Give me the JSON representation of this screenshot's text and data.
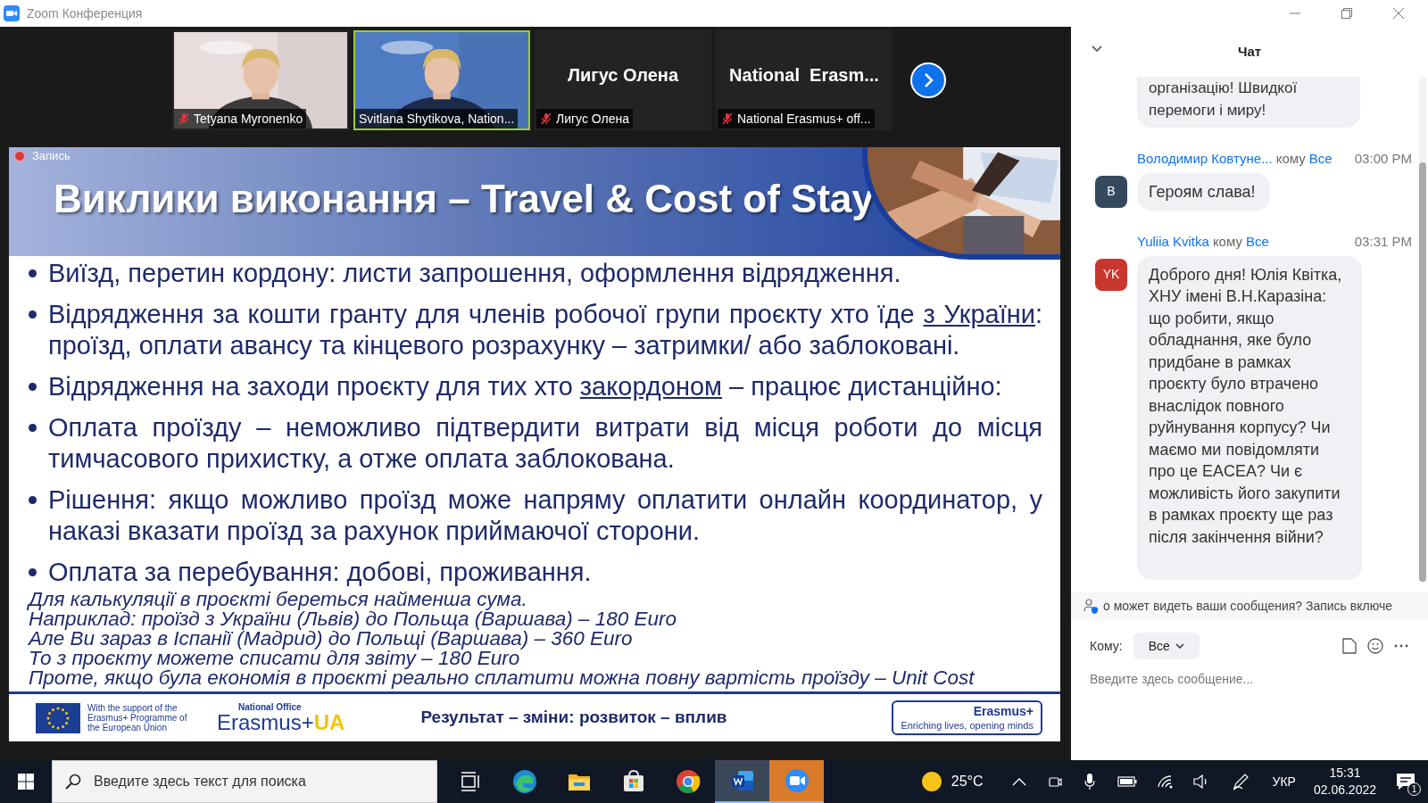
{
  "window": {
    "title": "Zoom Конференция"
  },
  "videos": [
    {
      "name": "Tetyana Myronenko",
      "kind": "camera",
      "muted": true,
      "speaking": false
    },
    {
      "name": "Svitlana Shytikova, Nation...",
      "kind": "camera",
      "muted": false,
      "speaking": true
    },
    {
      "name": "Лигус Олена",
      "kind": "name",
      "display": "Лигус Олена",
      "muted": true,
      "speaking": false
    },
    {
      "name": "National Erasmus+ off...",
      "kind": "name",
      "display": "National  Erasm...",
      "muted": true,
      "speaking": false
    }
  ],
  "recording": {
    "label": "Запись"
  },
  "slide": {
    "title": "Виклики виконання – Travel & Cost of Stay",
    "bullets": [
      {
        "segments": [
          {
            "text": "Виїзд, перетин кордону: листи запрошення, оформлення відрядження.",
            "underline": false
          }
        ]
      },
      {
        "segments": [
          {
            "text": "Відрядження за кошти гранту для членів робочої групи проєкту хто їде ",
            "underline": false
          },
          {
            "text": "з України",
            "underline": true
          },
          {
            "text": ": проїзд, оплати авансу та кінцевого розрахунку – затримки/ або заблоковані.",
            "underline": false
          }
        ]
      },
      {
        "segments": [
          {
            "text": "Відрядження на заходи проєкту для тих хто ",
            "underline": false
          },
          {
            "text": "закордоном",
            "underline": true
          },
          {
            "text": " – працює дистанційно:",
            "underline": false
          }
        ]
      },
      {
        "segments": [
          {
            "text": "Оплата проїзду – неможливо підтвердити витрати від місця роботи до місця тимчасового прихистку, а отже оплата заблокована.",
            "underline": false
          }
        ]
      },
      {
        "segments": [
          {
            "text": "Рішення: якщо можливо проїзд може напряму оплатити онлайн координатор, у наказі вказати проїзд за рахунок приймаючої сторони.",
            "underline": false
          }
        ]
      },
      {
        "segments": [
          {
            "text": "Оплата за перебування: добові, проживання.",
            "underline": false
          }
        ]
      }
    ],
    "notes": [
      "Для калькуляції в проєкті береться найменша сума.",
      "Наприклад: проїзд з України (Львів) до Польща (Варшава) – 180 Euro",
      "Але Ви зараз в Іспанії (Мадрид) до Польщі (Варшава) – 360 Euro",
      "То з проєкту можете списати для звіту – 180 Euro",
      "Проте, якщо була економія в проєкті реально сплатити можна повну вартість проїзду – Unit Cost"
    ],
    "footer": {
      "eu_text": "With the support of the Erasmus+ Programme of the European Union",
      "office_label": "National Office",
      "office_name": "Erasmus+",
      "office_suffix": "UA",
      "slogan": "Результат – зміни: розвиток – вплив",
      "badge_title": "Erasmus+",
      "badge_subtitle": "Enriching lives, opening minds"
    }
  },
  "chat": {
    "title": "Чат",
    "partial_message": "організацію! Швидкої перемоги і миру!",
    "messages": [
      {
        "sender": "Володимир Ковтуне...",
        "to_label": "кому",
        "to": "Все",
        "time": "03:00 PM",
        "initials": "В",
        "color": "#34495e",
        "text": "Героям слава!"
      },
      {
        "sender": "Yuliia Kvitka",
        "to_label": "кому",
        "to": "Все",
        "time": "03:31 PM",
        "initials": "YK",
        "color": "#c8372d",
        "text": "Доброго дня! Юлія Квітка, ХНУ імені В.Н.Каразіна: що робити, якщо обладнання, яке було придбане в рамках проєкту було втрачено внаслідок повного руйнування корпусу? Чи маємо ми повідомляти про це EACEA? Чи є можливість його закупити в рамках проєкту ще раз після закінчення війни?"
      }
    ],
    "notice": "о может видеть ваши сообщения? Запись включе",
    "to_label": "Кому:",
    "to_value": "Все",
    "placeholder": "Введите здесь сообщение..."
  },
  "taskbar": {
    "search_placeholder": "Введите здесь текст для поиска",
    "apps": [
      {
        "kind": "taskview",
        "open": false,
        "flashing": false
      },
      {
        "kind": "edge",
        "open": false,
        "flashing": false
      },
      {
        "kind": "explorer",
        "open": false,
        "flashing": false
      },
      {
        "kind": "store",
        "open": false,
        "flashing": false
      },
      {
        "kind": "chrome",
        "open": false,
        "flashing": false
      },
      {
        "kind": "word",
        "open": true,
        "flashing": false
      },
      {
        "kind": "zoom",
        "open": true,
        "flashing": true
      }
    ],
    "temperature": "25°C",
    "language": "УКР",
    "time": "15:31",
    "date": "02.06.2022",
    "notifications": "1"
  }
}
